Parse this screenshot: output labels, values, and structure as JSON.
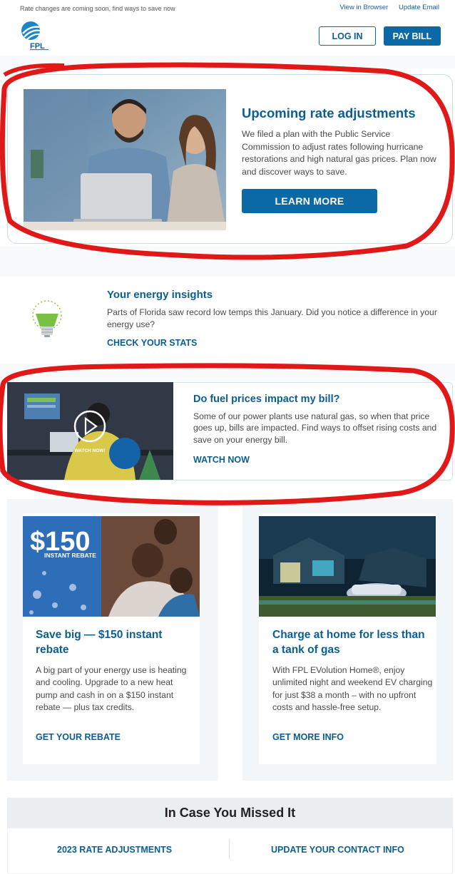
{
  "header": {
    "preheader": "Rate changes are coming soon, find ways to save now",
    "view_in_browser": "View in Browser",
    "update_email": "Update Email",
    "logo_text": "FPL",
    "login_label": "LOG IN",
    "pay_bill_label": "PAY BILL"
  },
  "hero": {
    "title": "Upcoming rate adjustments",
    "body": "We filed a plan with the Public Service Commission to adjust rates following hurricane restorations and high natural gas prices. Plan now and discover ways to save.",
    "cta": "LEARN MORE",
    "image_icon": "people-at-laptop-photo"
  },
  "insights": {
    "title": "Your energy insights",
    "body": "Parts of Florida saw record low temps this January. Did you notice a difference in your energy use?",
    "link": "CHECK YOUR STATS",
    "icon": "lightbulb-icon"
  },
  "fuel": {
    "title": "Do fuel prices impact my bill?",
    "body": "Some of our power plants use natural gas, so when that price goes up, bills are impacted. Find ways to offset rising costs and save on your energy bill.",
    "link": "WATCH NOW",
    "video_overlay": "WATCH NOW!"
  },
  "promos": [
    {
      "badge_amount": "$150",
      "badge_sub": "INSTANT REBATE",
      "title": "Save big — $150 instant rebate",
      "body": "A big part of your energy use is heating and cooling. Upgrade to a new heat pump and cash in on a $150 instant rebate — plus tax credits.",
      "link": "GET YOUR REBATE"
    },
    {
      "title": "Charge at home for less than a tank of gas",
      "body": "With FPL EVolution Home®, enjoy unlimited night and weekend EV charging for just $38 a month – with no upfront costs and hassle-free setup.",
      "link": "GET MORE INFO"
    }
  ],
  "icymi": {
    "heading": "In Case You Missed It",
    "links": [
      "2023 RATE ADJUSTMENTS",
      "UPDATE YOUR CONTACT INFO"
    ]
  },
  "colors": {
    "brand_blue": "#0b6aa6",
    "link_blue": "#0b5e93",
    "annotation_red": "#e01818"
  }
}
